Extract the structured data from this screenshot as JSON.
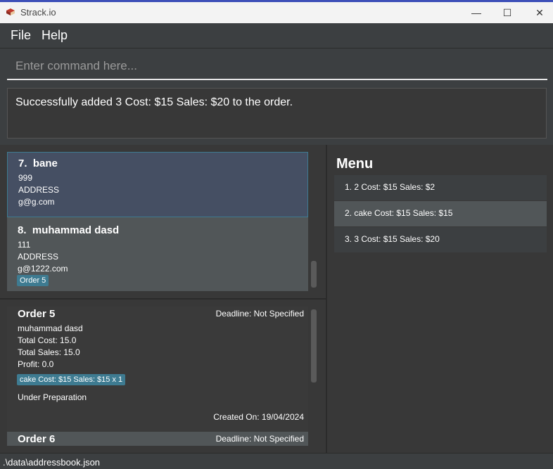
{
  "window": {
    "title": "Strack.io",
    "controls": {
      "minimize": "—",
      "maximize": "☐",
      "close": "✕"
    }
  },
  "menubar": {
    "items": [
      "File",
      "Help"
    ]
  },
  "command": {
    "placeholder": "Enter command here...",
    "value": ""
  },
  "result": {
    "message": "Successfully added 3 Cost: $15 Sales: $20 to the order."
  },
  "persons": [
    {
      "index": "7.",
      "name": "bane",
      "phone": "999",
      "address": "ADDRESS",
      "email": "g@g.com",
      "tags": []
    },
    {
      "index": "8.",
      "name": "muhammad dasd",
      "phone": "111",
      "address": "ADDRESS",
      "email": "g@1222.com",
      "tags": [
        "Order 5"
      ]
    }
  ],
  "orders": [
    {
      "title": "Order 5",
      "deadline": "Deadline: Not Specified",
      "customer": "muhammad dasd",
      "total_cost": "Total Cost: 15.0",
      "total_sales": "Total Sales: 15.0",
      "profit": "Profit: 0.0",
      "items_tag": "cake Cost: $15 Sales: $15 x 1",
      "status": "Under Preparation",
      "created": "Created On: 19/04/2024"
    },
    {
      "title": "Order 6",
      "deadline": "Deadline: Not Specified"
    }
  ],
  "menu": {
    "title": "Menu",
    "items": [
      "1. 2  Cost: $15  Sales: $2",
      "2. cake  Cost: $15  Sales: $15",
      "3. 3  Cost: $15  Sales: $20"
    ]
  },
  "status_bar": {
    "path": ".\\data\\addressbook.json"
  }
}
